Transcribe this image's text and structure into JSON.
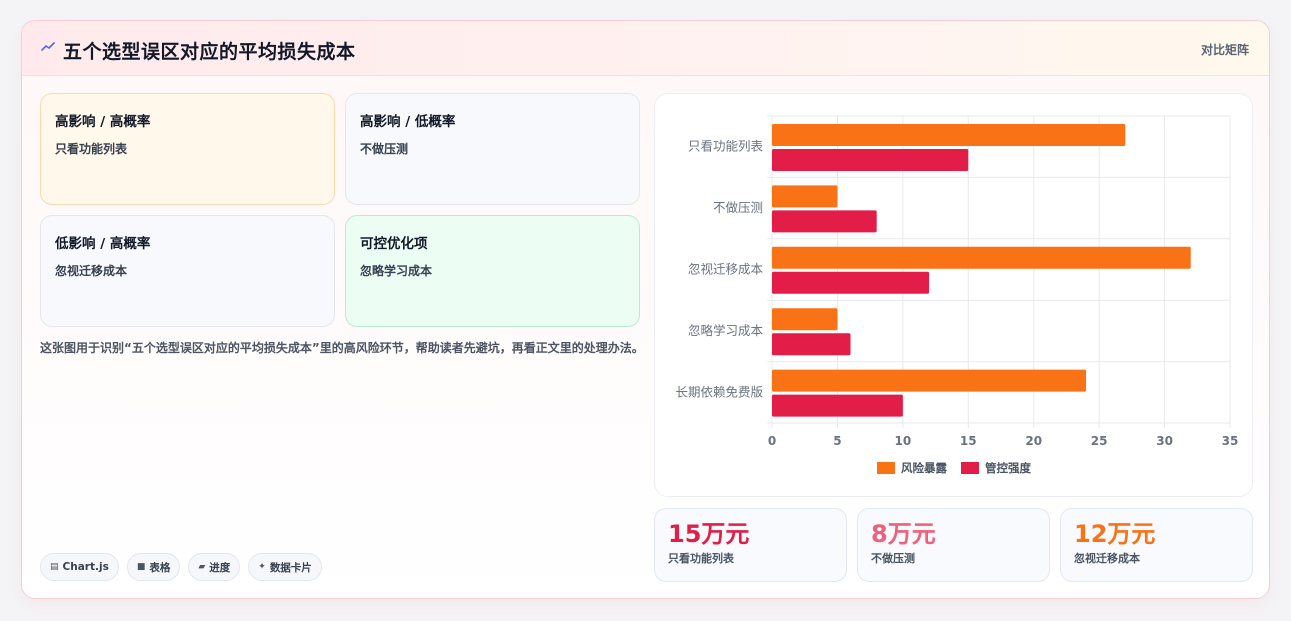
{
  "header": {
    "title": "五个选型误区对应的平均损失成本",
    "action_label": "对比矩阵"
  },
  "quadrants": [
    {
      "title": "高影响 / 高概率",
      "item": "只看功能列表"
    },
    {
      "title": "高影响 / 低概率",
      "item": "不做压测"
    },
    {
      "title": "低影响 / 高概率",
      "item": "忽视迁移成本"
    },
    {
      "title": "可控优化项",
      "item": "忽略学习成本"
    }
  ],
  "description": "这张图用于识别“五个选型误区对应的平均损失成本”里的高风险环节，帮助读者先避坑，再看正文里的处理办法。",
  "tags": [
    {
      "icon": "chart-icon",
      "label": "Chart.js"
    },
    {
      "icon": "table-icon",
      "label": "表格"
    },
    {
      "icon": "progress-icon",
      "label": "进度"
    },
    {
      "icon": "sparkle-icon",
      "label": "数据卡片"
    }
  ],
  "chart_data": {
    "type": "bar",
    "orientation": "horizontal",
    "categories": [
      "只看功能列表",
      "不做压测",
      "忽视迁移成本",
      "忽略学习成本",
      "长期依赖免费版"
    ],
    "series": [
      {
        "name": "风险暴露",
        "color": "#f97316",
        "values": [
          27,
          5,
          32,
          5,
          24
        ]
      },
      {
        "name": "管控强度",
        "color": "#e11d48",
        "values": [
          15,
          8,
          12,
          6,
          10
        ]
      }
    ],
    "xlim": [
      0,
      35
    ],
    "xticks": [
      "0",
      "5",
      "10",
      "15",
      "20",
      "25",
      "30",
      "35"
    ],
    "grid": true,
    "legend_position": "bottom"
  },
  "stats": [
    {
      "value": "15万元",
      "label": "只看功能列表",
      "color": "#e11d48"
    },
    {
      "value": "8万元",
      "label": "不做压测",
      "color": "#f0607a"
    },
    {
      "value": "12万元",
      "label": "忽视迁移成本",
      "color": "#f97316"
    }
  ],
  "colors": {
    "accent": "#e11d48",
    "orange": "#f97316"
  }
}
